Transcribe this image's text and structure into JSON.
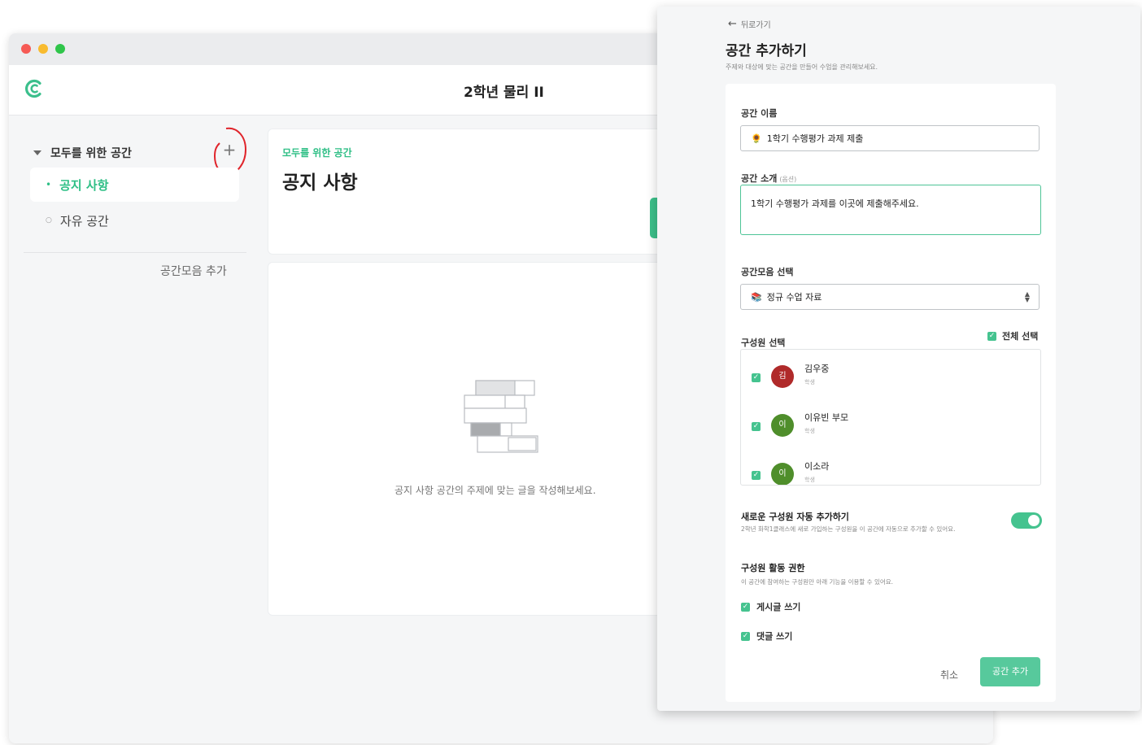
{
  "app": {
    "class_title": "2학년 물리 II",
    "sidebar": {
      "group_label": "모두를 위한 공간",
      "items": [
        {
          "label": "공지 사항",
          "active": true
        },
        {
          "label": "자유 공간",
          "active": false
        }
      ],
      "add_collection_label": "공간모음 추가"
    },
    "notice": {
      "group_label": "모두를 위한 공간",
      "title": "공지 사항"
    },
    "empty_state_text": "공지 사항 공간의 주제에 맞는 글을 작성해보세요."
  },
  "panel": {
    "back_label": "뒤로가기",
    "title": "공간 추가하기",
    "description": "주제와 대상에 맞는 공간을 만들어 수업을 관리해보세요.",
    "name_label": "공간 이름",
    "name_value": "1학기 수행평가 과제 제출",
    "name_icon": "sunflower-emoji",
    "intro_label": "공간 소개",
    "intro_optional": "(옵션)",
    "intro_value": "1학기 수행평가 과제를 이곳에 제출해주세요.",
    "collection_label": "공간모음 선택",
    "collection_value": "정규 수업 자료",
    "collection_icon": "books-emoji",
    "members_label": "구성원 선택",
    "select_all_label": "전체 선택",
    "members": [
      {
        "initial": "김",
        "name": "김우중",
        "role": "학생",
        "checked": true,
        "color": "#b02a2a"
      },
      {
        "initial": "이",
        "name": "이유빈 부모",
        "role": "학생",
        "checked": true,
        "color": "#4f8e2b"
      },
      {
        "initial": "이",
        "name": "이소라",
        "role": "학생",
        "checked": true,
        "color": "#4f8e2b"
      }
    ],
    "auto_add_title": "새로운 구성원 자동 추가하기",
    "auto_add_desc": "2학년 화학1클래스에 새로 가입하는 구성원을 이 공간에 자동으로 추가할 수 있어요.",
    "auto_add_on": true,
    "permissions_title": "구성원 활동 권한",
    "permissions_desc": "이 공간에 참여하는 구성원만 아래 기능을 이용할 수 있어요.",
    "permissions": [
      {
        "label": "게시글 쓰기",
        "checked": true
      },
      {
        "label": "댓글 쓰기",
        "checked": true
      }
    ],
    "cancel_label": "취소",
    "submit_label": "공간 추가"
  },
  "colors": {
    "accent": "#2fbf86",
    "button": "#57c99c"
  }
}
